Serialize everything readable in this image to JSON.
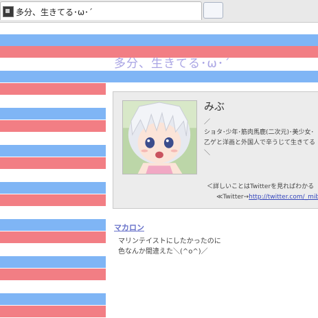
{
  "browser": {
    "tab_title": "多分、生きてる･ω･´",
    "favicon": "blog-favicon-icon"
  },
  "blog": {
    "title": "多分、生きてる･ω･´",
    "colors": {
      "stripe_blue": "#7fb5f5",
      "stripe_pink": "#f27e84",
      "title": "#a9a4e4"
    }
  },
  "profile": {
    "name": "みぶ",
    "lines": [
      "／",
      "ショタ･少年･筋肉馬鹿(二次元)･美少女･",
      "乙ゲと洋画と外国人で辛うじて生きてる",
      "＼"
    ],
    "note": "＜詳しいことはTwitterを見ればわかる",
    "twitter_prefix": "≪Twitter→",
    "twitter_link": "http://twitter.com/_mib",
    "avatar": "anime-avatar-image"
  },
  "entry": {
    "title": "マカロン",
    "lines": [
      "マリンテイストにしたかったのに",
      "色なんか間違えた＼(^o^)／"
    ]
  }
}
